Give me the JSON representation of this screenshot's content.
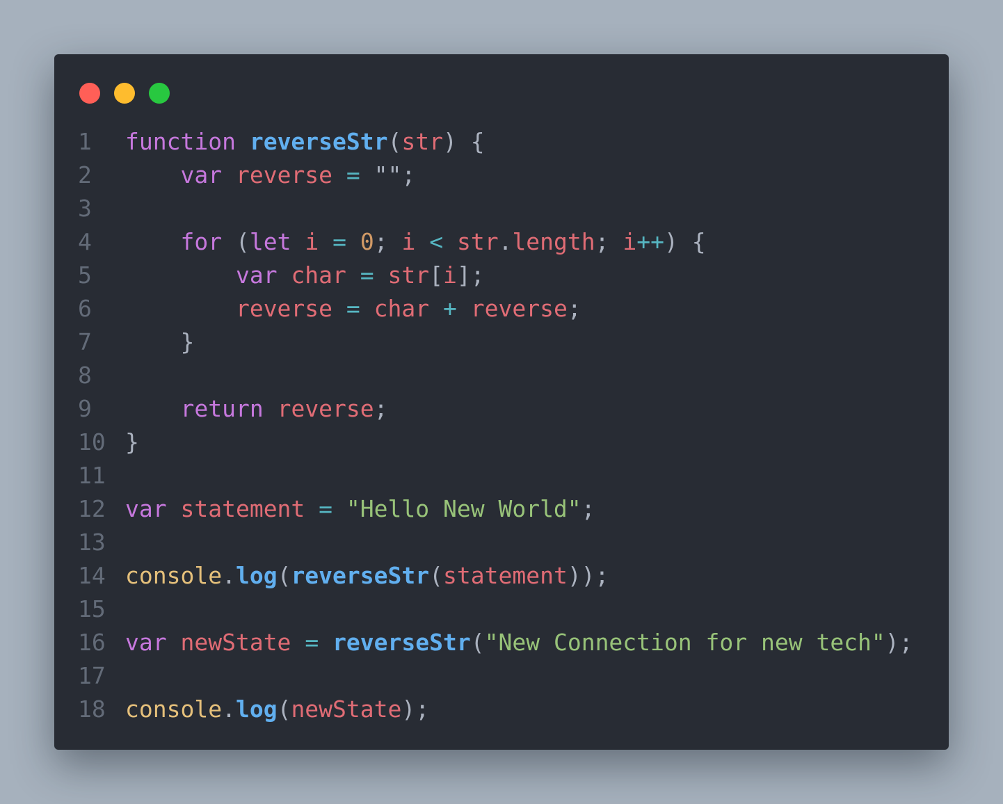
{
  "window": {
    "traffic_lights": [
      {
        "name": "close",
        "color": "#ff5f57"
      },
      {
        "name": "minimize",
        "color": "#febc2e"
      },
      {
        "name": "maximize",
        "color": "#28c840"
      }
    ]
  },
  "theme": {
    "keyword": "#c678dd",
    "function": "#61afef",
    "variable": "#e06c75",
    "string": "#98c379",
    "number": "#d19a66",
    "operator": "#56b6c2",
    "object": "#e5c07b",
    "plain": "#abb2bf",
    "line_number": "#636b78",
    "background": "#282c34"
  },
  "code": {
    "language": "javascript",
    "lines": [
      {
        "n": "1",
        "tokens": [
          [
            "kw",
            "function"
          ],
          [
            "plain",
            " "
          ],
          [
            "fn",
            "reverseStr"
          ],
          [
            "plain",
            "("
          ],
          [
            "var",
            "str"
          ],
          [
            "plain",
            ") {"
          ]
        ]
      },
      {
        "n": "2",
        "tokens": [
          [
            "plain",
            "    "
          ],
          [
            "kw",
            "var"
          ],
          [
            "plain",
            " "
          ],
          [
            "var",
            "reverse"
          ],
          [
            "plain",
            " "
          ],
          [
            "op",
            "="
          ],
          [
            "plain",
            " \"\";"
          ]
        ]
      },
      {
        "n": "3",
        "tokens": []
      },
      {
        "n": "4",
        "tokens": [
          [
            "plain",
            "    "
          ],
          [
            "kw",
            "for"
          ],
          [
            "plain",
            " ("
          ],
          [
            "kw",
            "let"
          ],
          [
            "plain",
            " "
          ],
          [
            "var",
            "i"
          ],
          [
            "plain",
            " "
          ],
          [
            "op",
            "="
          ],
          [
            "plain",
            " "
          ],
          [
            "num",
            "0"
          ],
          [
            "plain",
            "; "
          ],
          [
            "var",
            "i"
          ],
          [
            "plain",
            " "
          ],
          [
            "op",
            "<"
          ],
          [
            "plain",
            " "
          ],
          [
            "var",
            "str"
          ],
          [
            "plain",
            "."
          ],
          [
            "var",
            "length"
          ],
          [
            "plain",
            "; "
          ],
          [
            "var",
            "i"
          ],
          [
            "op",
            "++"
          ],
          [
            "plain",
            ") {"
          ]
        ]
      },
      {
        "n": "5",
        "tokens": [
          [
            "plain",
            "        "
          ],
          [
            "kw",
            "var"
          ],
          [
            "plain",
            " "
          ],
          [
            "var",
            "char"
          ],
          [
            "plain",
            " "
          ],
          [
            "op",
            "="
          ],
          [
            "plain",
            " "
          ],
          [
            "var",
            "str"
          ],
          [
            "plain",
            "["
          ],
          [
            "var",
            "i"
          ],
          [
            "plain",
            "];"
          ]
        ]
      },
      {
        "n": "6",
        "tokens": [
          [
            "plain",
            "        "
          ],
          [
            "var",
            "reverse"
          ],
          [
            "plain",
            " "
          ],
          [
            "op",
            "="
          ],
          [
            "plain",
            " "
          ],
          [
            "var",
            "char"
          ],
          [
            "plain",
            " "
          ],
          [
            "op",
            "+"
          ],
          [
            "plain",
            " "
          ],
          [
            "var",
            "reverse"
          ],
          [
            "plain",
            ";"
          ]
        ]
      },
      {
        "n": "7",
        "tokens": [
          [
            "plain",
            "    }"
          ]
        ]
      },
      {
        "n": "8",
        "tokens": []
      },
      {
        "n": "9",
        "tokens": [
          [
            "plain",
            "    "
          ],
          [
            "kw",
            "return"
          ],
          [
            "plain",
            " "
          ],
          [
            "var",
            "reverse"
          ],
          [
            "plain",
            ";"
          ]
        ]
      },
      {
        "n": "10",
        "tokens": [
          [
            "plain",
            "}"
          ]
        ]
      },
      {
        "n": "11",
        "tokens": []
      },
      {
        "n": "12",
        "tokens": [
          [
            "kw",
            "var"
          ],
          [
            "plain",
            " "
          ],
          [
            "var",
            "statement"
          ],
          [
            "plain",
            " "
          ],
          [
            "op",
            "="
          ],
          [
            "plain",
            " "
          ],
          [
            "str",
            "\"Hello New World\""
          ],
          [
            "plain",
            ";"
          ]
        ]
      },
      {
        "n": "13",
        "tokens": []
      },
      {
        "n": "14",
        "tokens": [
          [
            "obj",
            "console"
          ],
          [
            "plain",
            "."
          ],
          [
            "fn",
            "log"
          ],
          [
            "plain",
            "("
          ],
          [
            "fn",
            "reverseStr"
          ],
          [
            "plain",
            "("
          ],
          [
            "var",
            "statement"
          ],
          [
            "plain",
            "));"
          ]
        ]
      },
      {
        "n": "15",
        "tokens": []
      },
      {
        "n": "16",
        "tokens": [
          [
            "kw",
            "var"
          ],
          [
            "plain",
            " "
          ],
          [
            "var",
            "newState"
          ],
          [
            "plain",
            " "
          ],
          [
            "op",
            "="
          ],
          [
            "plain",
            " "
          ],
          [
            "fn",
            "reverseStr"
          ],
          [
            "plain",
            "("
          ],
          [
            "str",
            "\"New Connection for new tech\""
          ],
          [
            "plain",
            ");"
          ]
        ]
      },
      {
        "n": "17",
        "tokens": []
      },
      {
        "n": "18",
        "tokens": [
          [
            "obj",
            "console"
          ],
          [
            "plain",
            "."
          ],
          [
            "fn",
            "log"
          ],
          [
            "plain",
            "("
          ],
          [
            "var",
            "newState"
          ],
          [
            "plain",
            ");"
          ]
        ]
      }
    ]
  }
}
